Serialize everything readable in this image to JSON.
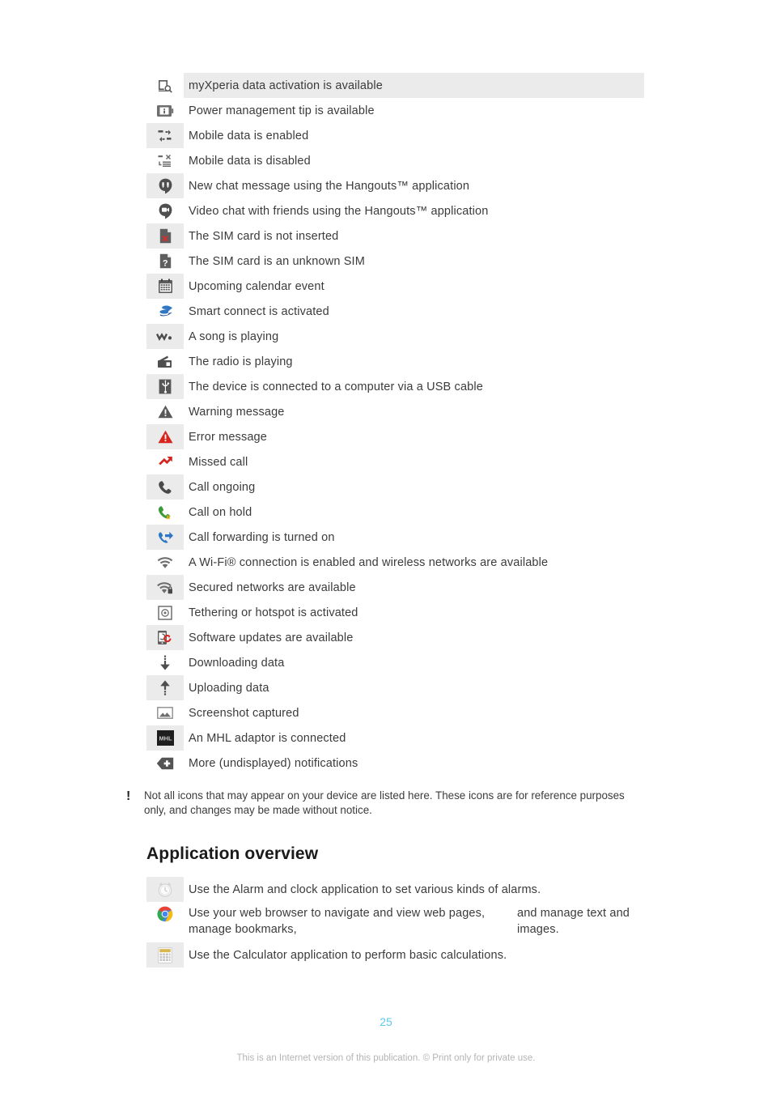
{
  "page": {
    "number": "25",
    "footer_note": "This is an Internet version of this publication. © Print only for private use."
  },
  "status_icons": {
    "rows": [
      {
        "icon": "myxperia-data-activation-icon",
        "label": "myXperia data activation is available"
      },
      {
        "icon": "power-management-tip-icon",
        "label": "Power management tip is available"
      },
      {
        "icon": "mobile-data-enabled-icon",
        "label": "Mobile data is enabled"
      },
      {
        "icon": "mobile-data-disabled-icon",
        "label": "Mobile data is disabled"
      },
      {
        "icon": "hangouts-new-chat-icon",
        "label": "New chat message using the Hangouts™ application"
      },
      {
        "icon": "hangouts-video-chat-icon",
        "label": "Video chat with friends using the Hangouts™ application"
      },
      {
        "icon": "sim-card-not-inserted-icon",
        "label": "The SIM card is not inserted"
      },
      {
        "icon": "sim-card-unknown-icon",
        "label": "The SIM card is an unknown SIM"
      },
      {
        "icon": "calendar-event-icon",
        "label": "Upcoming calendar event"
      },
      {
        "icon": "smart-connect-icon",
        "label": "Smart connect is activated"
      },
      {
        "icon": "music-playing-icon",
        "label": "A song is playing"
      },
      {
        "icon": "radio-playing-icon",
        "label": "The radio is playing"
      },
      {
        "icon": "usb-connected-icon",
        "label": "The device is connected to a computer via a USB cable"
      },
      {
        "icon": "warning-icon",
        "label": "Warning message"
      },
      {
        "icon": "error-icon",
        "label": "Error message"
      },
      {
        "icon": "missed-call-icon",
        "label": "Missed call"
      },
      {
        "icon": "call-ongoing-icon",
        "label": "Call ongoing"
      },
      {
        "icon": "call-on-hold-icon",
        "label": "Call on hold"
      },
      {
        "icon": "call-forwarding-icon",
        "label": "Call forwarding is turned on"
      },
      {
        "icon": "wifi-available-icon",
        "label": "A Wi-Fi® connection is enabled and wireless networks are available"
      },
      {
        "icon": "wifi-secured-icon",
        "label": "Secured networks are available"
      },
      {
        "icon": "tethering-hotspot-icon",
        "label": "Tethering or hotspot is activated"
      },
      {
        "icon": "software-update-icon",
        "label": "Software updates are available"
      },
      {
        "icon": "download-icon",
        "label": "Downloading data"
      },
      {
        "icon": "upload-icon",
        "label": "Uploading data"
      },
      {
        "icon": "screenshot-icon",
        "label": "Screenshot captured"
      },
      {
        "icon": "mhl-adaptor-icon",
        "label": "An MHL adaptor is connected"
      },
      {
        "icon": "more-notifications-icon",
        "label": "More (undisplayed) notifications"
      }
    ]
  },
  "note": {
    "mark": "!",
    "text": "Not all icons that may appear on your device are listed here. These icons are for reference purposes only, and changes may be made without notice."
  },
  "heading": {
    "application_overview": "Application overview"
  },
  "application_overview": {
    "rows": [
      {
        "icon": "alarm-clock-icon",
        "line1": "Use the Alarm and clock application to set various kinds of alarms.",
        "line2": ""
      },
      {
        "icon": "web-browser-icon",
        "line1": "Use your web browser to navigate and view web pages, manage bookmarks,",
        "line2": "and manage text and images."
      },
      {
        "icon": "calculator-icon",
        "line1": "Use the Calculator application to perform basic calculations.",
        "line2": ""
      }
    ]
  },
  "colors": {
    "stripe": "#ebebeb",
    "text": "#3b3b3b",
    "page_number": "#5bc8ec",
    "footer": "#b4b4b4",
    "red": "#d32f2f",
    "blue": "#2f6fbf",
    "green": "#3c9a3c"
  }
}
